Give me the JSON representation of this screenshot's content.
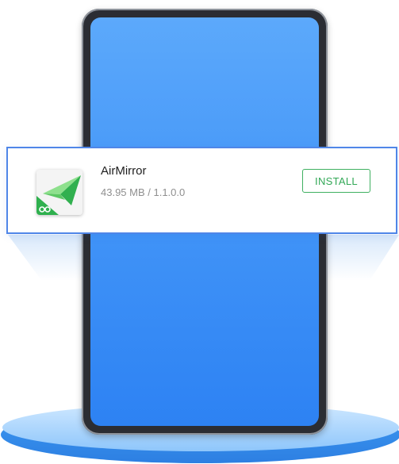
{
  "app": {
    "name": "AirMirror",
    "meta": "43.95 MB / 1.1.0.0",
    "icon": "airmirror-icon"
  },
  "actions": {
    "install_label": "INSTALL"
  },
  "colors": {
    "accent_green": "#3fb061",
    "card_border": "#4f86e8",
    "screen_blue": "#3f92f7"
  }
}
